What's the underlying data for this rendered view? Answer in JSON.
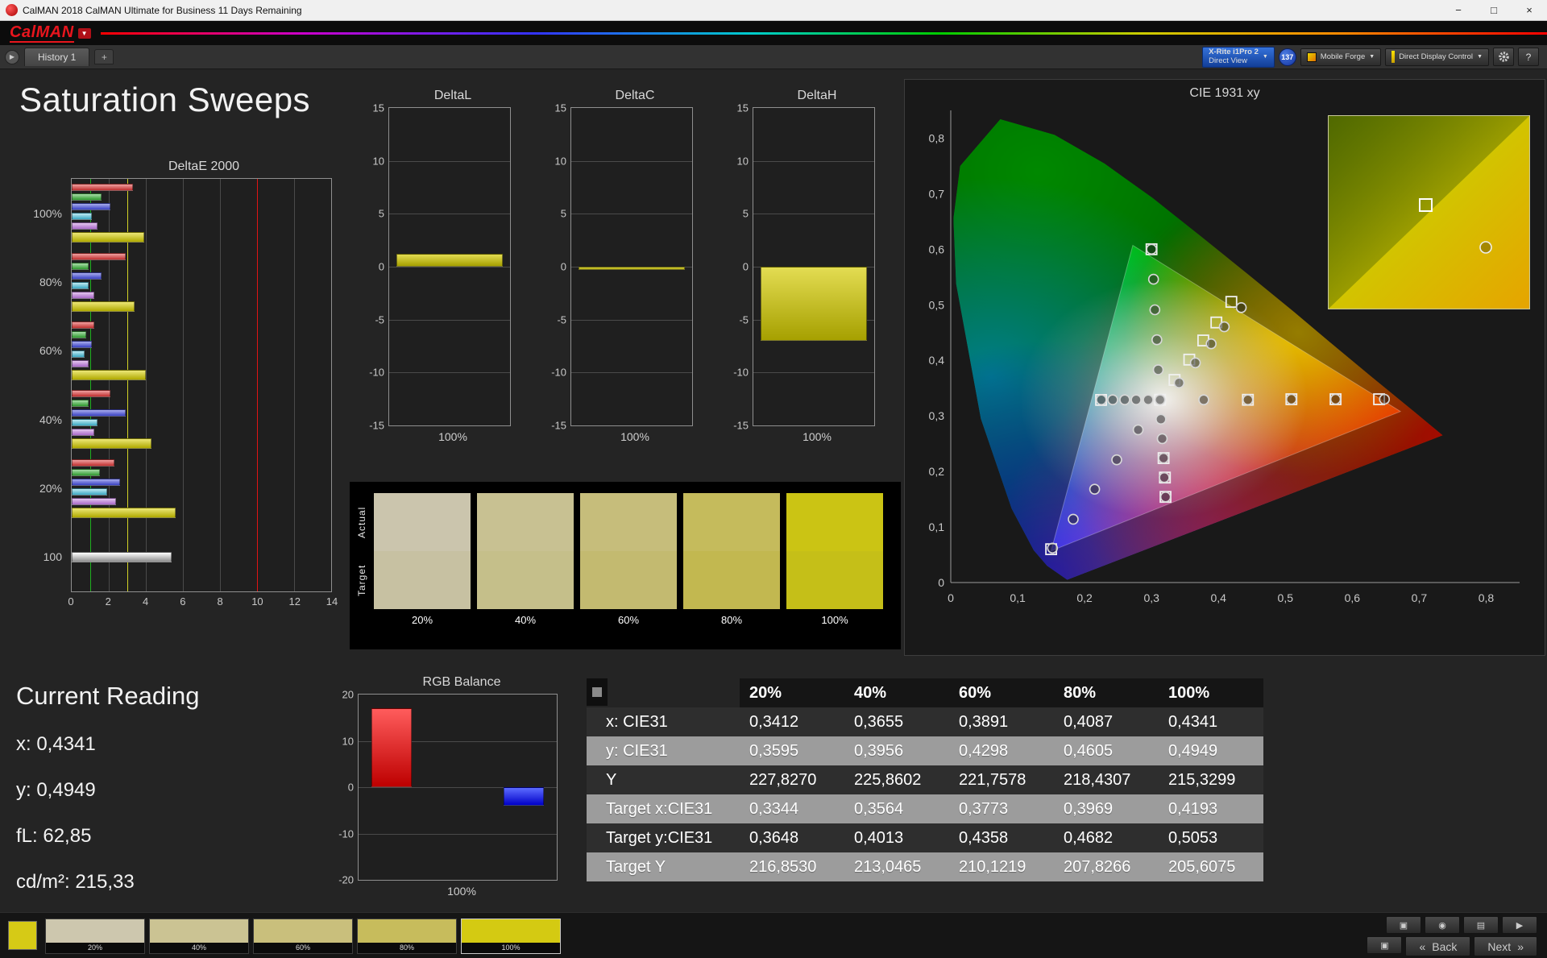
{
  "window": {
    "title": "CalMAN 2018 CalMAN Ultimate for Business 11 Days Remaining",
    "controls": {
      "minimize": "−",
      "maximize": "□",
      "close": "×"
    }
  },
  "logo": {
    "brand": "CalMAN",
    "caret": "▼"
  },
  "tabbar": {
    "expander": "▶",
    "tab": "History 1",
    "add_tab": "+",
    "meter_button": {
      "line1": "X-Rite i1Pro 2",
      "line2": "Direct View",
      "caret": "▼"
    },
    "badge": "137",
    "source_button": {
      "label": "Mobile Forge",
      "caret": "▼"
    },
    "control_button": {
      "label": "Direct Display Control",
      "caret": "▼"
    },
    "help_button": "?"
  },
  "page": {
    "title": "Saturation Sweeps"
  },
  "current_reading": {
    "title": "Current Reading",
    "lines": [
      "x: 0,4341",
      "y: 0,4949",
      "fL: 62,85",
      "cd/m²: 215,33"
    ]
  },
  "swatches": {
    "row_labels": [
      "Actual",
      "Target"
    ],
    "columns": [
      {
        "label": "20%",
        "actual": "#cbc5ad",
        "target": "#c7c1a2"
      },
      {
        "label": "40%",
        "actual": "#c8c192",
        "target": "#c5bf8a"
      },
      {
        "label": "60%",
        "actual": "#c6bd7b",
        "target": "#c3ba70"
      },
      {
        "label": "80%",
        "actual": "#c5bb5c",
        "target": "#c2b850"
      },
      {
        "label": "100%",
        "actual": "#cbc414",
        "target": "#c5bf18"
      }
    ]
  },
  "table": {
    "headers": [
      "",
      "20%",
      "40%",
      "60%",
      "80%",
      "100%"
    ],
    "rows": [
      {
        "label": "x: CIE31",
        "values": [
          "0,3412",
          "0,3655",
          "0,3891",
          "0,4087",
          "0,4341"
        ]
      },
      {
        "label": "y: CIE31",
        "values": [
          "0,3595",
          "0,3956",
          "0,4298",
          "0,4605",
          "0,4949"
        ]
      },
      {
        "label": "Y",
        "values": [
          "227,8270",
          "225,8602",
          "221,7578",
          "218,4307",
          "215,3299"
        ]
      },
      {
        "label": "Target x:CIE31",
        "values": [
          "0,3344",
          "0,3564",
          "0,3773",
          "0,3969",
          "0,4193"
        ]
      },
      {
        "label": "Target y:CIE31",
        "values": [
          "0,3648",
          "0,4013",
          "0,4358",
          "0,4682",
          "0,5053"
        ]
      },
      {
        "label": "Target Y",
        "values": [
          "216,8530",
          "213,0465",
          "210,1219",
          "207,8266",
          "205,6075"
        ]
      }
    ]
  },
  "bottom": {
    "current_color": "#d6ca16",
    "swatches": [
      {
        "label": "20%",
        "color": "#cdc7ae",
        "selected": false
      },
      {
        "label": "40%",
        "color": "#cbc393",
        "selected": false
      },
      {
        "label": "60%",
        "color": "#c9bf7c",
        "selected": false
      },
      {
        "label": "80%",
        "color": "#c7bc5c",
        "selected": false
      },
      {
        "label": "100%",
        "color": "#d4ca12",
        "selected": true
      }
    ],
    "tools": [
      {
        "name": "pattern-window",
        "glyph": "▣"
      },
      {
        "name": "capture",
        "glyph": "◉"
      },
      {
        "name": "report",
        "glyph": "▤"
      },
      {
        "name": "play",
        "glyph": "▶"
      }
    ],
    "display_button": "▣",
    "back": {
      "glyph": "«",
      "label": "Back"
    },
    "next": {
      "glyph": "»",
      "label": "Next"
    }
  },
  "chart_data": [
    {
      "name": "deltaE2000",
      "type": "bar",
      "orientation": "horizontal",
      "title": "DeltaE 2000",
      "xlim": [
        0,
        14
      ],
      "xticks": [
        0,
        2,
        4,
        6,
        8,
        10,
        12,
        14
      ],
      "reference_lines": [
        {
          "value": 1,
          "color": "#1faf1f"
        },
        {
          "value": 3,
          "color": "#d3d326"
        },
        {
          "value": 10,
          "color": "#e01414"
        }
      ],
      "groups": [
        {
          "label": "100%",
          "bars": [
            [
              "red",
              3.3
            ],
            [
              "green",
              1.6
            ],
            [
              "blue",
              2.1
            ],
            [
              "cyan",
              1.1
            ],
            [
              "magenta",
              1.4
            ],
            [
              "yellow",
              3.9
            ]
          ]
        },
        {
          "label": "80%",
          "bars": [
            [
              "red",
              2.9
            ],
            [
              "green",
              0.9
            ],
            [
              "blue",
              1.6
            ],
            [
              "cyan",
              0.9
            ],
            [
              "magenta",
              1.2
            ],
            [
              "yellow",
              3.4
            ]
          ]
        },
        {
          "label": "60%",
          "bars": [
            [
              "red",
              1.2
            ],
            [
              "green",
              0.8
            ],
            [
              "blue",
              1.1
            ],
            [
              "cyan",
              0.7
            ],
            [
              "magenta",
              0.9
            ],
            [
              "yellow",
              4.0
            ]
          ]
        },
        {
          "label": "40%",
          "bars": [
            [
              "red",
              2.1
            ],
            [
              "green",
              0.9
            ],
            [
              "blue",
              2.9
            ],
            [
              "cyan",
              1.4
            ],
            [
              "magenta",
              1.2
            ],
            [
              "yellow",
              4.3
            ]
          ]
        },
        {
          "label": "20%",
          "bars": [
            [
              "red",
              2.3
            ],
            [
              "green",
              1.5
            ],
            [
              "blue",
              2.6
            ],
            [
              "cyan",
              1.9
            ],
            [
              "magenta",
              2.4
            ],
            [
              "yellow",
              5.6
            ]
          ]
        },
        {
          "label": "100",
          "bars": [
            [
              "white",
              5.4
            ]
          ]
        }
      ]
    },
    {
      "name": "deltaL",
      "type": "bar",
      "title": "DeltaL",
      "ylim": [
        -15,
        15
      ],
      "yticks": [
        15,
        10,
        5,
        0,
        -5,
        -10,
        -15
      ],
      "categories": [
        "100%"
      ],
      "values": [
        1.2
      ],
      "bar_color": [
        "#e3dc52",
        "#a6a000"
      ]
    },
    {
      "name": "deltaC",
      "type": "bar",
      "title": "DeltaC",
      "ylim": [
        -15,
        15
      ],
      "yticks": [
        15,
        10,
        5,
        0,
        -5,
        -10,
        -15
      ],
      "categories": [
        "100%"
      ],
      "values": [
        -0.3
      ],
      "bar_color": [
        "#e3dc52",
        "#a6a000"
      ]
    },
    {
      "name": "deltaH",
      "type": "bar",
      "title": "DeltaH",
      "ylim": [
        -15,
        15
      ],
      "yticks": [
        15,
        10,
        5,
        0,
        -5,
        -10,
        -15
      ],
      "categories": [
        "100%"
      ],
      "values": [
        -7.0
      ],
      "bar_color": [
        "#e3dc52",
        "#a6a000"
      ]
    },
    {
      "name": "rgb_balance",
      "type": "bar",
      "title": "RGB Balance",
      "ylim": [
        -20,
        20
      ],
      "yticks": [
        20,
        10,
        0,
        -10,
        -20
      ],
      "categories": [
        "100%"
      ],
      "series": [
        {
          "name": "Red",
          "color": [
            "#ff5c5c",
            "#bd0000"
          ],
          "values": [
            17
          ]
        },
        {
          "name": "Green",
          "color": [
            "#5cff5c",
            "#00a000"
          ],
          "values": [
            0
          ]
        },
        {
          "name": "Blue",
          "color": [
            "#5c6cff",
            "#0000c8"
          ],
          "values": [
            -4
          ]
        }
      ]
    },
    {
      "name": "cie1931",
      "type": "scatter",
      "title": "CIE 1931 xy",
      "xlim": [
        0,
        0.8
      ],
      "ylim": [
        0,
        0.8
      ],
      "xticks": [
        "0",
        "0,1",
        "0,2",
        "0,3",
        "0,4",
        "0,5",
        "0,6",
        "0,7",
        "0,8"
      ],
      "yticks": [
        "0",
        "0,1",
        "0,2",
        "0,3",
        "0,4",
        "0,5",
        "0,6",
        "0,7",
        "0,8"
      ],
      "gamut_triangle": [
        [
          0.672,
          0.308
        ],
        [
          0.272,
          0.607
        ],
        [
          0.15,
          0.057
        ]
      ],
      "white_point": [
        0.3127,
        0.329
      ],
      "sweeps": [
        {
          "name": "yellow",
          "measured": [
            [
              0.3412,
              0.3595
            ],
            [
              0.3655,
              0.3956
            ],
            [
              0.3891,
              0.4298
            ],
            [
              0.4087,
              0.4605
            ],
            [
              0.4341,
              0.4949
            ]
          ],
          "targets": [
            [
              0.3344,
              0.3648
            ],
            [
              0.3564,
              0.4013
            ],
            [
              0.3773,
              0.4358
            ],
            [
              0.3969,
              0.4682
            ],
            [
              0.4193,
              0.5053
            ]
          ]
        },
        {
          "name": "red",
          "measured": [
            [
              0.378,
              0.329
            ],
            [
              0.444,
              0.329
            ],
            [
              0.509,
              0.33
            ],
            [
              0.575,
              0.33
            ],
            [
              0.648,
              0.33
            ]
          ],
          "targets": [
            [
              0.444,
              0.329
            ],
            [
              0.509,
              0.33
            ],
            [
              0.575,
              0.33
            ],
            [
              0.64,
              0.33
            ]
          ]
        },
        {
          "name": "green",
          "measured": [
            [
              0.31,
              0.383
            ],
            [
              0.308,
              0.437
            ],
            [
              0.305,
              0.491
            ],
            [
              0.303,
              0.546
            ],
            [
              0.3,
              0.6
            ]
          ],
          "targets": [
            [
              0.3,
              0.6
            ]
          ]
        },
        {
          "name": "blue",
          "measured": [
            [
              0.28,
              0.275
            ],
            [
              0.248,
              0.221
            ],
            [
              0.215,
              0.168
            ],
            [
              0.183,
              0.114
            ],
            [
              0.152,
              0.062
            ]
          ],
          "targets": [
            [
              0.15,
              0.06
            ]
          ]
        },
        {
          "name": "cyan",
          "measured": [
            [
              0.295,
              0.329
            ],
            [
              0.277,
              0.329
            ],
            [
              0.26,
              0.329
            ],
            [
              0.242,
              0.329
            ],
            [
              0.225,
              0.329
            ]
          ],
          "targets": [
            [
              0.2246,
              0.3287
            ]
          ]
        },
        {
          "name": "magenta",
          "measured": [
            [
              0.314,
              0.294
            ],
            [
              0.316,
              0.259
            ],
            [
              0.318,
              0.224
            ],
            [
              0.319,
              0.189
            ],
            [
              0.321,
              0.154
            ]
          ],
          "targets": [
            [
              0.318,
              0.224
            ],
            [
              0.32,
              0.189
            ],
            [
              0.3209,
              0.1542
            ]
          ]
        }
      ]
    }
  ]
}
